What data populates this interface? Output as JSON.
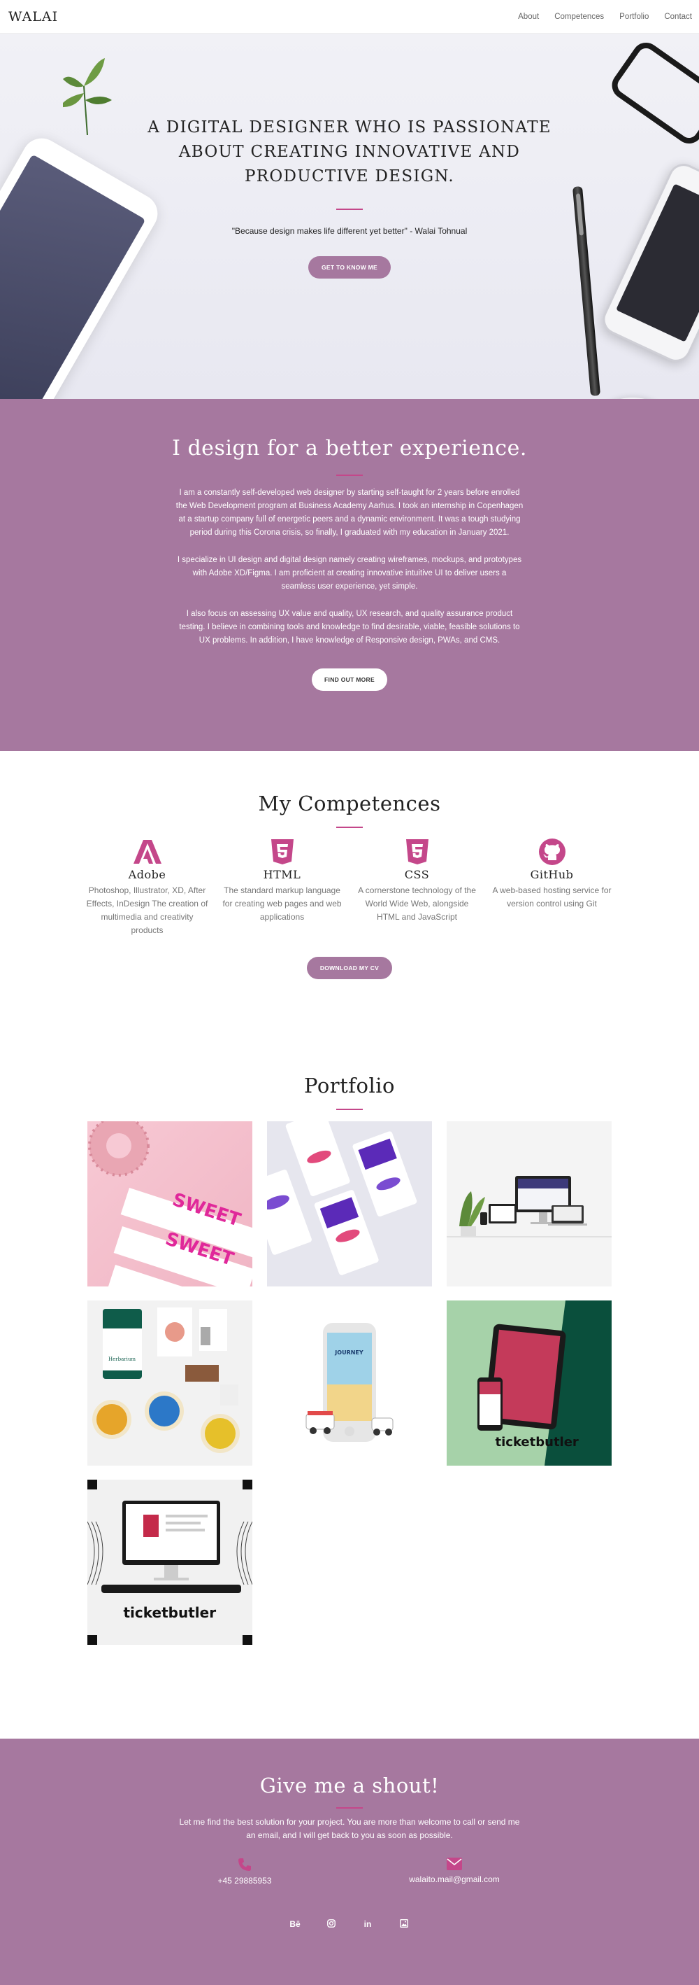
{
  "nav": {
    "logo": "WALAI",
    "links": [
      "About",
      "Competences",
      "Portfolio",
      "Contact"
    ]
  },
  "hero": {
    "headline": "A DIGITAL DESIGNER WHO IS PASSIONATE ABOUT CREATING INNOVATIVE AND PRODUCTIVE DESIGN.",
    "quote": "\"Because design makes life different yet better\" - Walai Tohnual",
    "button": "GET TO KNOW ME"
  },
  "about": {
    "title": "I design for a better experience.",
    "paragraphs": [
      "I am a constantly self-developed web designer by starting self-taught for 2 years before enrolled the Web Development program at Business Academy Aarhus. I took an internship in Copenhagen at a startup company full of energetic peers and a dynamic environment. It was a tough studying period during this Corona crisis, so finally, I graduated with my education in January 2021.",
      "I specialize in UI design and digital design namely creating wireframes, mockups, and prototypes with Adobe XD/Figma. I am proficient at creating innovative intuitive UI to deliver users a seamless user experience, yet simple.",
      "I also focus on assessing UX value and quality, UX research, and quality assurance product testing. I believe in combining tools and knowledge to find desirable, viable, feasible solutions to UX problems. In addition, I have knowledge of Responsive design, PWAs, and CMS."
    ],
    "button": "FIND OUT MORE"
  },
  "competences": {
    "title": "My Competences",
    "items": [
      {
        "icon": "adobe-icon",
        "name": "Adobe",
        "desc": "Photoshop, Illustrator, XD, After Effects, InDesign The creation of multimedia and creativity products"
      },
      {
        "icon": "html5-icon",
        "name": "HTML",
        "desc": "The standard markup language for creating web pages and web applications"
      },
      {
        "icon": "css3-icon",
        "name": "CSS",
        "desc": "A cornerstone technology of the World Wide Web, alongside HTML and JavaScript"
      },
      {
        "icon": "github-icon",
        "name": "GitHub",
        "desc": "A web-based hosting service for version control using Git"
      }
    ],
    "button": "DOWNLOAD MY CV"
  },
  "portfolio": {
    "title": "Portfolio",
    "tiles": {
      "t1": "SWEET",
      "t4": "Herbarium",
      "t5": "JOURNEY",
      "t6": "ticketbutler",
      "t7": "ticketbutler"
    }
  },
  "contact": {
    "title": "Give me a shout!",
    "text": "Let me find the best solution for your project. You are more than welcome to call or send me an email, and I will get back to you as soon as possible.",
    "phone": "+45 29885953",
    "email": "walaito.mail@gmail.com",
    "socials": [
      "Bē",
      "instagram-icon",
      "in",
      "image-icon"
    ]
  },
  "colors": {
    "accent": "#a6789f",
    "pink": "#c4478a"
  }
}
